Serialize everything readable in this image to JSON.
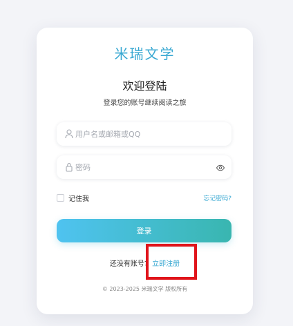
{
  "brand": "米瑞文学",
  "title": "欢迎登陆",
  "subtitle": "登录您的账号继续阅读之旅",
  "username": {
    "placeholder": "用户名或邮箱或QQ",
    "value": "",
    "icon": "user-icon"
  },
  "password": {
    "placeholder": "密码",
    "value": "",
    "icon": "lock-icon",
    "toggle_icon": "eye-icon"
  },
  "remember_label": "记住我",
  "remember_checked": false,
  "forgot_label": "忘记密码?",
  "login_label": "登录",
  "register": {
    "prompt": "还没有账号?",
    "link": "立即注册"
  },
  "copyright": "© 2023-2025 米瑞文学 版权所有",
  "colors": {
    "accent": "#38a8d2",
    "button_start": "#4fc3f0",
    "button_end": "#39b6b0",
    "highlight": "#e0141b"
  }
}
